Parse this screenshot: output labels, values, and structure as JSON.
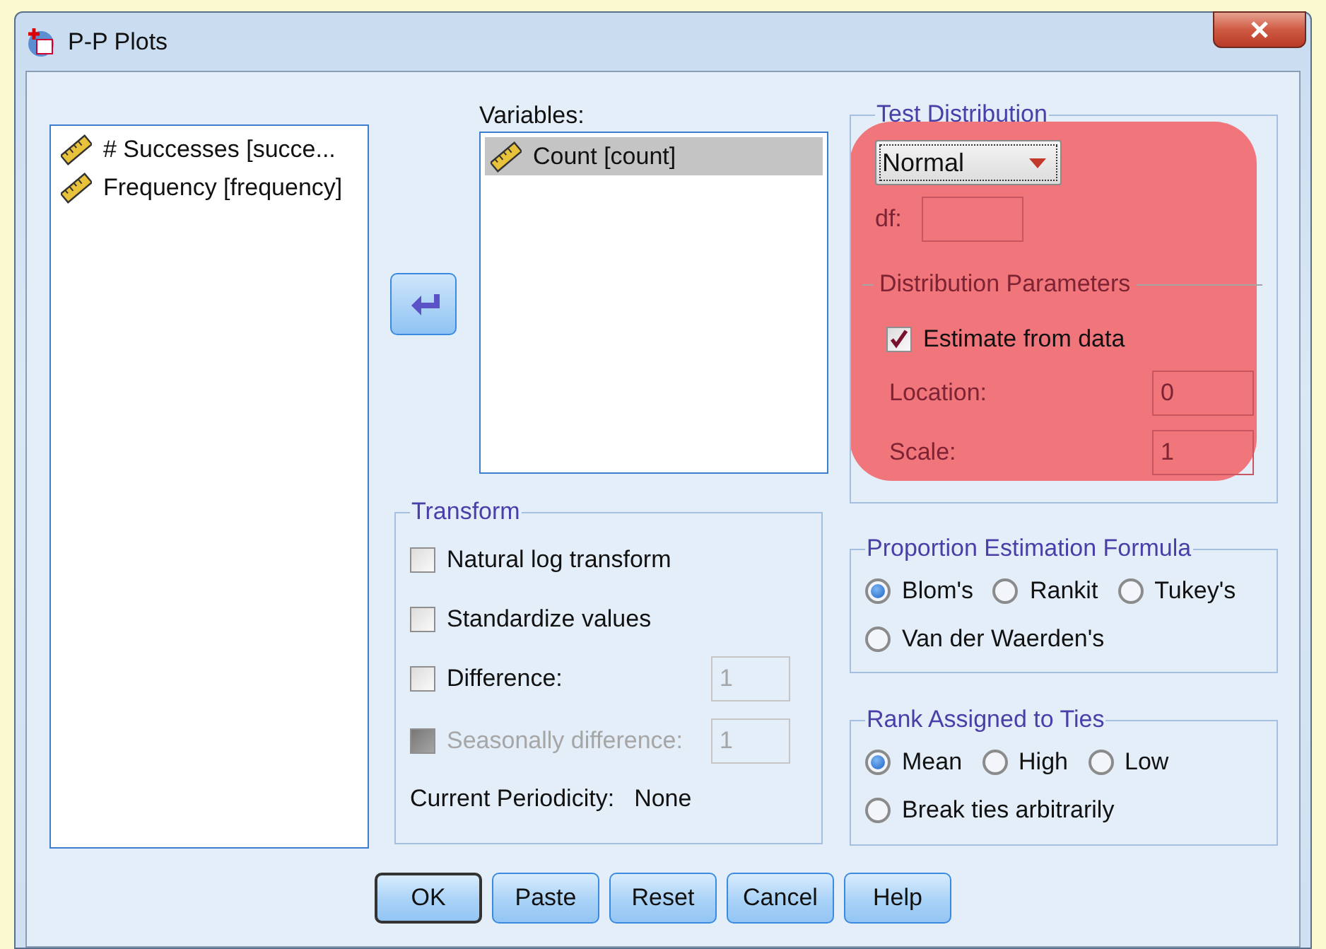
{
  "window": {
    "title": "P-P Plots"
  },
  "source_list": {
    "items": [
      {
        "label": "# Successes [succe...",
        "selected": false
      },
      {
        "label": "Frequency [frequency]",
        "selected": false
      }
    ]
  },
  "variables": {
    "label": "Variables:",
    "items": [
      {
        "label": "Count [count]",
        "selected": true
      }
    ]
  },
  "transform": {
    "title": "Transform",
    "options": [
      {
        "label": "Natural log transform",
        "checked": false,
        "disabled": false
      },
      {
        "label": "Standardize values",
        "checked": false,
        "disabled": false
      },
      {
        "label": "Difference:",
        "checked": false,
        "disabled": false,
        "value": "1"
      },
      {
        "label": "Seasonally difference:",
        "checked": false,
        "disabled": true,
        "value": "1"
      }
    ],
    "periodicity_label": "Current Periodicity:",
    "periodicity_value": "None"
  },
  "test_distribution": {
    "title": "Test Distribution",
    "distribution": "Normal",
    "highlighted": true,
    "df": {
      "label": "df:",
      "disabled": true
    },
    "parameters": {
      "title": "Distribution Parameters",
      "estimate": {
        "label": "Estimate from data",
        "checked": true
      },
      "fields": [
        {
          "label": "Location:",
          "value": "0",
          "disabled": true
        },
        {
          "label": "Scale:",
          "value": "1",
          "disabled": true
        }
      ]
    }
  },
  "proportion": {
    "title": "Proportion Estimation Formula",
    "rows": [
      [
        {
          "label": "Blom's",
          "selected": true
        },
        {
          "label": "Rankit",
          "selected": false
        },
        {
          "label": "Tukey's",
          "selected": false
        }
      ],
      [
        {
          "label": "Van der Waerden's",
          "selected": false
        }
      ]
    ]
  },
  "ties": {
    "title": "Rank Assigned to Ties",
    "rows": [
      [
        {
          "label": "Mean",
          "selected": true
        },
        {
          "label": "High",
          "selected": false
        },
        {
          "label": "Low",
          "selected": false
        }
      ],
      [
        {
          "label": "Break ties arbitrarily",
          "selected": false
        }
      ]
    ]
  },
  "buttons": [
    {
      "label": "OK",
      "default": true
    },
    {
      "label": "Paste",
      "default": false
    },
    {
      "label": "Reset",
      "default": false
    },
    {
      "label": "Cancel",
      "default": false
    },
    {
      "label": "Help",
      "default": false
    }
  ]
}
